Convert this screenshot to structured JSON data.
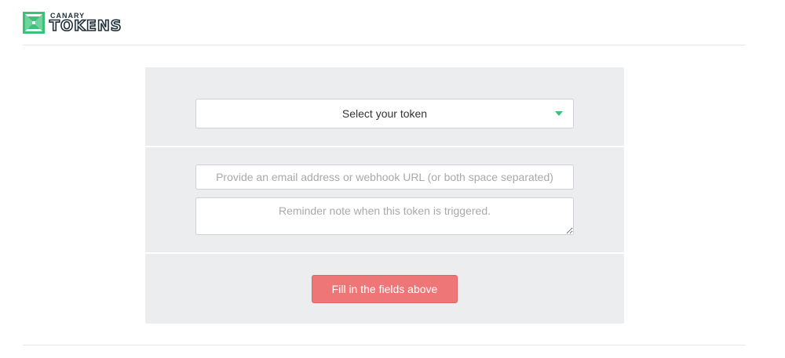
{
  "header": {
    "logo": {
      "top_word": "CANARY",
      "bottom_word": "TOKENS",
      "icon": "canary-logo-icon",
      "icon_color": "#3cc07a"
    }
  },
  "form": {
    "token_select": {
      "selected_label": "Select your token",
      "caret_icon": "caret-down-icon",
      "caret_color": "#3cc07a"
    },
    "email": {
      "value": "",
      "placeholder": "Provide an email address or webhook URL (or both space separated)"
    },
    "memo": {
      "value": "",
      "placeholder": "Reminder note when this token is triggered."
    },
    "submit": {
      "label": "Fill in the fields above",
      "color": "#ef7676"
    }
  }
}
